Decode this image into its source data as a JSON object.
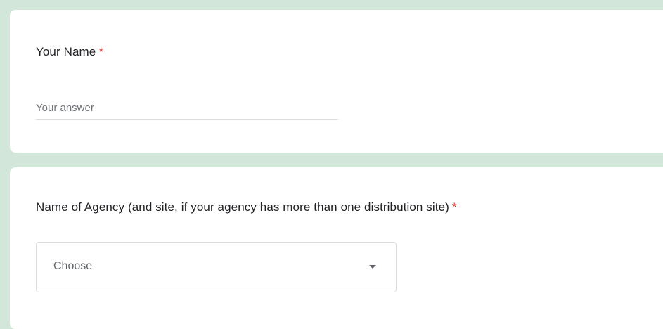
{
  "form": {
    "questions": [
      {
        "title": "Your Name",
        "required_marker": "*",
        "input": {
          "value": "",
          "placeholder": "Your answer"
        }
      },
      {
        "title": "Name of Agency (and site, if your agency has more than one distribution site)",
        "required_marker": "*",
        "dropdown": {
          "selected": "Choose",
          "icon": "caret-down-icon"
        }
      }
    ]
  },
  "colors": {
    "background": "#d3e6da",
    "card": "#ffffff",
    "required": "#d93025",
    "text": "#202124",
    "placeholder": "#70757a",
    "border": "#dadce0"
  }
}
